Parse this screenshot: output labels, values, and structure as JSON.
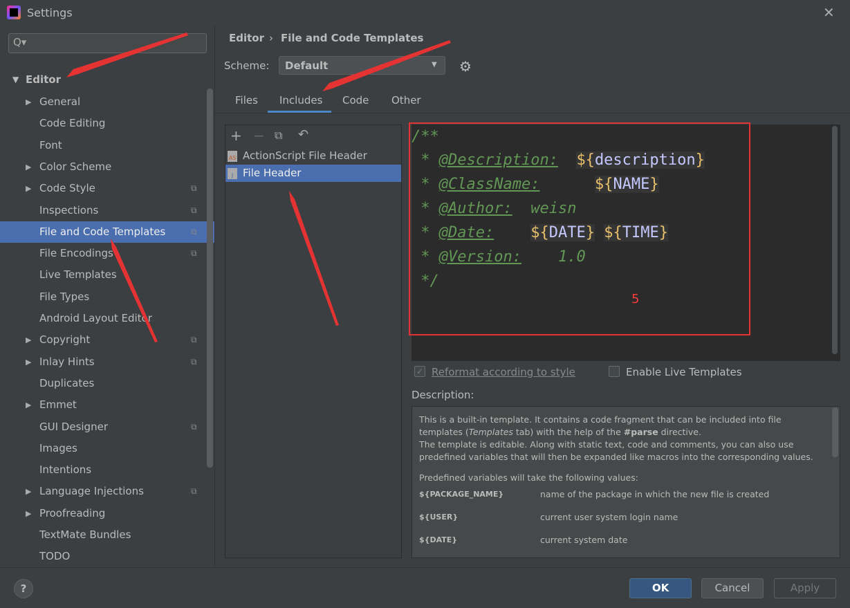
{
  "window": {
    "title": "Settings",
    "close": "✕"
  },
  "search": {
    "placeholder": "Q▾"
  },
  "sidebar": {
    "root": "Editor",
    "items": [
      {
        "label": "General",
        "arrow": true,
        "copy": false
      },
      {
        "label": "Code Editing",
        "arrow": false,
        "copy": false
      },
      {
        "label": "Font",
        "arrow": false,
        "copy": false
      },
      {
        "label": "Color Scheme",
        "arrow": true,
        "copy": false
      },
      {
        "label": "Code Style",
        "arrow": true,
        "copy": true
      },
      {
        "label": "Inspections",
        "arrow": false,
        "copy": true
      },
      {
        "label": "File and Code Templates",
        "arrow": false,
        "copy": true,
        "selected": true
      },
      {
        "label": "File Encodings",
        "arrow": false,
        "copy": true
      },
      {
        "label": "Live Templates",
        "arrow": false,
        "copy": false
      },
      {
        "label": "File Types",
        "arrow": false,
        "copy": false
      },
      {
        "label": "Android Layout Editor",
        "arrow": false,
        "copy": false
      },
      {
        "label": "Copyright",
        "arrow": true,
        "copy": true
      },
      {
        "label": "Inlay Hints",
        "arrow": true,
        "copy": true
      },
      {
        "label": "Duplicates",
        "arrow": false,
        "copy": false
      },
      {
        "label": "Emmet",
        "arrow": true,
        "copy": false
      },
      {
        "label": "GUI Designer",
        "arrow": false,
        "copy": true
      },
      {
        "label": "Images",
        "arrow": false,
        "copy": false
      },
      {
        "label": "Intentions",
        "arrow": false,
        "copy": false
      },
      {
        "label": "Language Injections",
        "arrow": true,
        "copy": true
      },
      {
        "label": "Proofreading",
        "arrow": true,
        "copy": false
      },
      {
        "label": "TextMate Bundles",
        "arrow": false,
        "copy": false
      },
      {
        "label": "TODO",
        "arrow": false,
        "copy": false
      }
    ]
  },
  "breadcrumb": {
    "parent": "Editor",
    "sep": "›",
    "current": "File and Code Templates"
  },
  "scheme": {
    "label": "Scheme:",
    "value": "Default"
  },
  "tabs": [
    "Files",
    "Includes",
    "Code",
    "Other"
  ],
  "active_tab": "Includes",
  "list": {
    "items": [
      {
        "label": "ActionScript File Header",
        "icon": "AS"
      },
      {
        "label": "File Header",
        "icon": "J",
        "selected": true
      }
    ]
  },
  "template": {
    "l1": "/**",
    "description_tag": "@Description:",
    "description_var": "description",
    "classname_tag": "@ClassName:",
    "classname_var": "NAME",
    "author_tag": "@Author:",
    "author_val": "weisn",
    "date_tag": "@Date:",
    "date_var": "DATE",
    "time_var": "TIME",
    "version_tag": "@Version:",
    "version_val": "1.0",
    "end": "*/"
  },
  "annotation": {
    "number": "5",
    "color": "#e53333"
  },
  "options": {
    "reformat": "Reformat according to style",
    "reformat_checked": true,
    "live": "Enable Live Templates",
    "live_checked": false
  },
  "description": {
    "label": "Description:",
    "p1a": "This is a built-in template. It contains a code fragment that can be included into file",
    "p1b": "templates (",
    "p1c": "Templates",
    "p1d": " tab) with the help of the ",
    "p1e": "#parse",
    "p1f": " directive.",
    "p2a": "The template is editable. Along with static text, code and comments, you can also use",
    "p2b": "predefined variables that will then be expanded like macros into the corresponding values.",
    "p3": "Predefined variables will take the following values:",
    "vars": [
      {
        "name": "${PACKAGE_NAME}",
        "desc": "name of the package in which the new file is created"
      },
      {
        "name": "${USER}",
        "desc": "current user system login name"
      },
      {
        "name": "${DATE}",
        "desc": "current system date"
      }
    ]
  },
  "buttons": {
    "help": "?",
    "ok": "OK",
    "cancel": "Cancel",
    "apply": "Apply"
  },
  "colors": {
    "accent": "#4b6eaf",
    "ok": "#365880",
    "comment": "#629755",
    "var_dollar": "#e8bf6a",
    "var_name": "#c5c8ff"
  }
}
